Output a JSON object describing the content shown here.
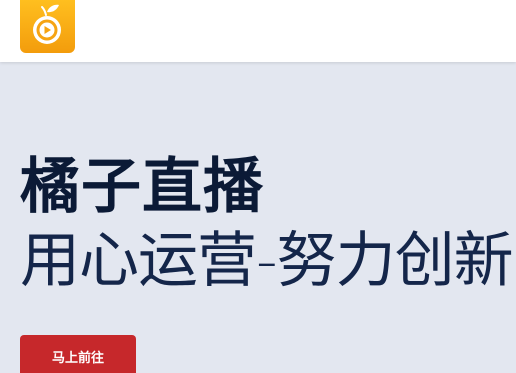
{
  "header": {
    "logo_icon": "orange-play-logo-icon",
    "logo_colors": {
      "from": "#ffbf1f",
      "to": "#f39c0c"
    }
  },
  "hero": {
    "title": "橘子直播",
    "subtitle": "用心运营-努力创新",
    "cta_label": "马上前往"
  },
  "colors": {
    "background": "#e3e7f0",
    "title": "#0b1a36",
    "cta": "#c6282b"
  }
}
